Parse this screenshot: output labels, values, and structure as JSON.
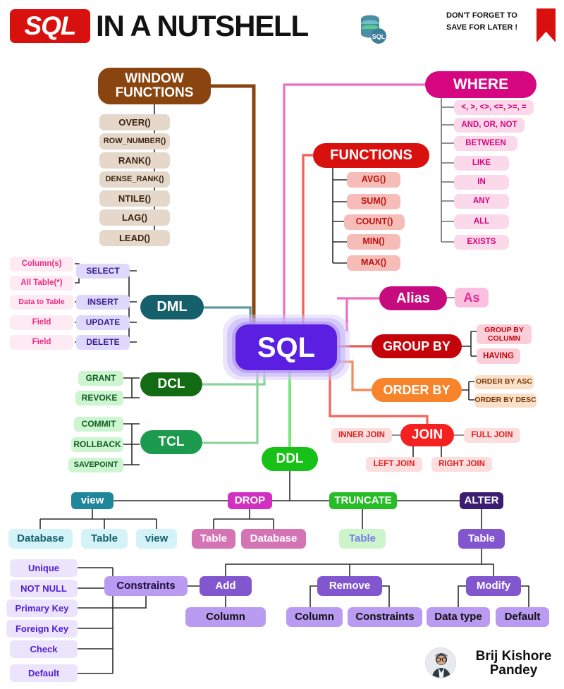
{
  "header": {
    "logo": "SQL",
    "title": "IN A NUTSHELL",
    "db_icon_label": "SQL",
    "save_line1": "DON'T FORGET TO",
    "save_line2": "SAVE FOR LATER !",
    "bookmark_icon": "bookmark-icon"
  },
  "center": {
    "label": "SQL"
  },
  "window_functions": {
    "title_line1": "WINDOW",
    "title_line2": "FUNCTIONS",
    "items": [
      "OVER()",
      "ROW_NUMBER()",
      "RANK()",
      "DENSE_RANK()",
      "NTILE()",
      "LAG()",
      "LEAD()"
    ]
  },
  "where": {
    "title": "WHERE",
    "items": [
      "<, >, <>, <=, >=, =",
      "AND, OR, NOT",
      "BETWEEN",
      "LIKE",
      "IN",
      "ANY",
      "ALL",
      "EXISTS"
    ]
  },
  "functions": {
    "title": "FUNCTIONS",
    "items": [
      "AVG()",
      "SUM()",
      "COUNT()",
      "MIN()",
      "MAX()"
    ]
  },
  "dml": {
    "title": "DML",
    "commands": [
      "SELECT",
      "INSERT",
      "UPDATE",
      "DELETE"
    ],
    "details": [
      "Column(s)",
      "All Table(*)",
      "Data to Table",
      "Field",
      "Field"
    ]
  },
  "dcl": {
    "title": "DCL",
    "items": [
      "GRANT",
      "REVOKE"
    ]
  },
  "tcl": {
    "title": "TCL",
    "items": [
      "COMMIT",
      "ROLLBACK",
      "SAVEPOINT"
    ]
  },
  "alias": {
    "title": "Alias",
    "item": "As"
  },
  "group_by": {
    "title": "GROUP BY",
    "items": [
      "GROUP BY\nCOLUMN",
      "HAVING"
    ],
    "item1_line1": "GROUP BY",
    "item1_line2": "COLUMN",
    "item2": "HAVING"
  },
  "order_by": {
    "title": "ORDER BY",
    "items": [
      "ORDER BY ASC",
      "ORDER BY DESC"
    ]
  },
  "join": {
    "title": "JOIN",
    "left": "INNER JOIN",
    "right": "FULL JOIN",
    "bottom_left": "LEFT JOIN",
    "bottom_right": "RIGHT JOIN"
  },
  "ddl": {
    "title": "DDL",
    "view": {
      "title": "view",
      "items": [
        "Database",
        "Table",
        "view"
      ]
    },
    "drop": {
      "title": "DROP",
      "items": [
        "Table",
        "Database"
      ]
    },
    "truncate": {
      "title": "TRUNCATE",
      "items": [
        "Table"
      ]
    },
    "alter": {
      "title": "ALTER",
      "items": [
        "Table"
      ]
    }
  },
  "alter_table": {
    "add": {
      "title": "Add",
      "items": [
        "Column"
      ]
    },
    "remove": {
      "title": "Remove",
      "items": [
        "Column",
        "Constraints"
      ]
    },
    "modify": {
      "title": "Modify",
      "items": [
        "Data type",
        "Default"
      ]
    },
    "constraints": {
      "title": "Constraints",
      "items": [
        "Unique",
        "NOT NULL",
        "Primary Key",
        "Foreign Key",
        "Check",
        "Default"
      ]
    }
  },
  "footer": {
    "author": "Brij Kishore Pandey",
    "avatar_icon": "avatar-photo"
  },
  "colors": {
    "center": "#5a1fe0",
    "window_functions": "#8a4410",
    "where": "#d5067f",
    "functions": "#d8110f",
    "dml": "#15606b",
    "dcl": "#136b13",
    "tcl": "#1c9b4e",
    "alias": "#c60b7e",
    "group_by": "#c4040a",
    "order_by": "#f7842a",
    "join": "#f52020",
    "ddl": "#18c117",
    "view": "#20869c",
    "drop": "#d230c0",
    "truncate": "#27bd27",
    "alter": "#3b1d72",
    "logo_red": "#d8110f"
  }
}
